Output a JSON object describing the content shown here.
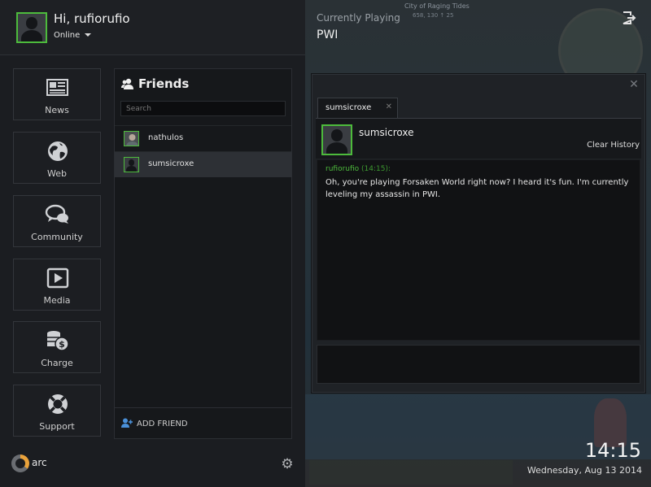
{
  "user": {
    "greeting": "Hi, rufiorufio",
    "status": "Online"
  },
  "nav": [
    {
      "label": "News",
      "icon": "newspaper-icon"
    },
    {
      "label": "Web",
      "icon": "globe-icon"
    },
    {
      "label": "Community",
      "icon": "chat-bubbles-icon"
    },
    {
      "label": "Media",
      "icon": "play-icon"
    },
    {
      "label": "Charge",
      "icon": "coins-icon"
    },
    {
      "label": "Support",
      "icon": "lifebuoy-icon"
    }
  ],
  "friends": {
    "title": "Friends",
    "search_placeholder": "Search",
    "list": [
      {
        "name": "nathulos",
        "selected": false
      },
      {
        "name": "sumsicroxe",
        "selected": true
      }
    ],
    "add_label": "ADD FRIEND"
  },
  "brand": {
    "logo_text": "arc"
  },
  "game": {
    "playing_label": "Currently Playing",
    "title": "PWI",
    "location": "City of Raging Tides",
    "coords": "658, 130  ↑ 25"
  },
  "chat": {
    "tab_label": "sumsicroxe",
    "contact_name": "sumsicroxe",
    "clear_history": "Clear History",
    "messages": [
      {
        "author": "rufiorufio",
        "time": "(14:15):",
        "text": "Oh, you're playing Forsaken World right now? I heard it's fun. I'm currently leveling my assassin in PWI."
      }
    ]
  },
  "clock": {
    "time": "14:15",
    "date": "Wednesday, Aug 13 2014"
  },
  "colors": {
    "accent_green": "#4dbb3c",
    "panel_bg": "#1b1d21",
    "chat_bg": "#111214"
  }
}
